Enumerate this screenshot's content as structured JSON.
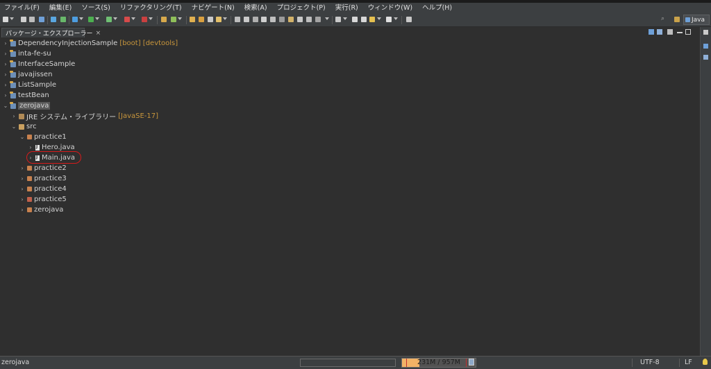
{
  "menu": {
    "items": [
      "ファイル(F)",
      "編集(E)",
      "ソース(S)",
      "リファクタリング(T)",
      "ナビゲート(N)",
      "検索(A)",
      "プロジェクト(P)",
      "実行(R)",
      "ウィンドウ(W)",
      "ヘルプ(H)"
    ]
  },
  "perspective": {
    "label": "Java"
  },
  "view": {
    "tab_label": "パッケージ・エクスプローラー",
    "close_glyph": "×"
  },
  "tree": {
    "projects": [
      {
        "label": "DependencyInjectionSample",
        "decoration": "[boot] [devtools]",
        "chevron": "›"
      },
      {
        "label": "inta-fe-su",
        "chevron": "›"
      },
      {
        "label": "InterfaceSample",
        "chevron": "›"
      },
      {
        "label": "javajissen",
        "chevron": "›"
      },
      {
        "label": "ListSample",
        "chevron": "›"
      },
      {
        "label": "testBean",
        "chevron": "›"
      },
      {
        "label": "zerojava",
        "chevron": "⌄"
      }
    ],
    "jre": {
      "label": "JRE システム・ライブラリー",
      "decoration": "[JavaSE-17]"
    },
    "src": {
      "label": "src"
    },
    "packages": [
      {
        "label": "practice1"
      },
      {
        "label": "practice2"
      },
      {
        "label": "practice3"
      },
      {
        "label": "practice4"
      },
      {
        "label": "practice5"
      },
      {
        "label": "zerojava"
      }
    ],
    "files": [
      {
        "label": "Hero.java"
      },
      {
        "label": "Main.java"
      }
    ]
  },
  "status": {
    "selected": "zerojava",
    "heap": "231M / 957M",
    "heap_used_fraction": 0.24,
    "encoding": "UTF-8",
    "line_delimiter": "LF"
  },
  "colors": {
    "background": "#2f2f2f",
    "annotation_circle": "#d81b1b",
    "decoration": "#c8963c",
    "heap_fill": "#f2b266"
  }
}
